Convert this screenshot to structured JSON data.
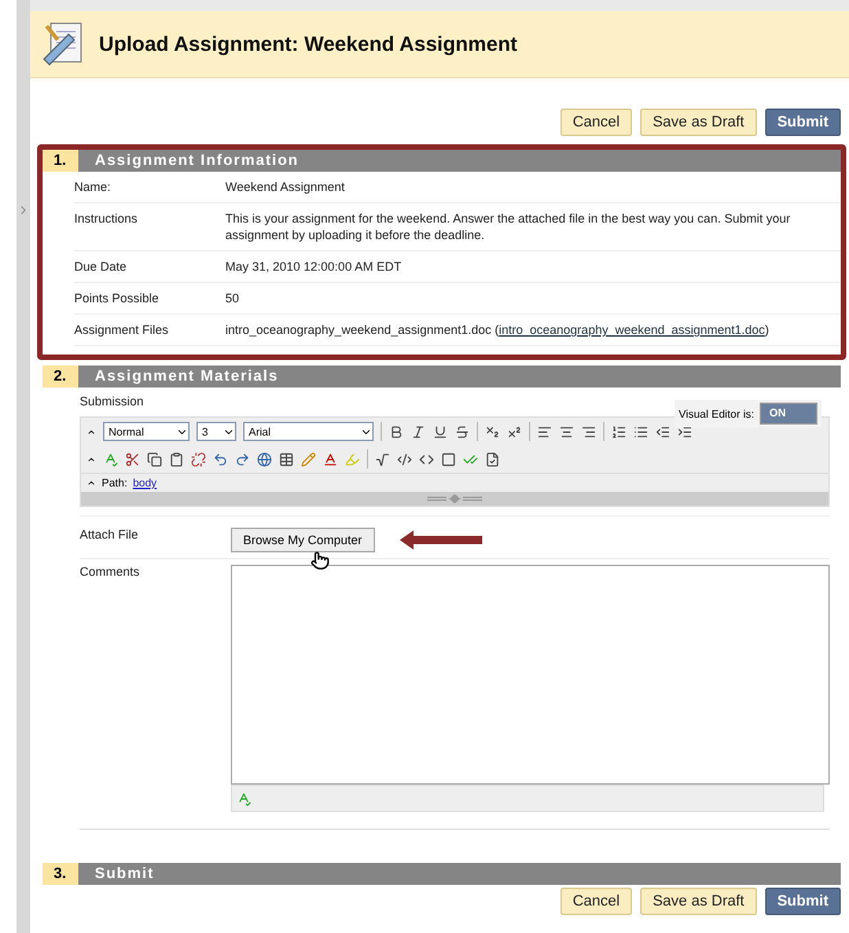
{
  "page_title": "Upload Assignment: Weekend Assignment",
  "top_buttons": [
    {
      "label": "Cancel",
      "kind": "plain"
    },
    {
      "label": "Save as Draft",
      "kind": "plain"
    },
    {
      "label": "Submit",
      "kind": "primary"
    }
  ],
  "info_section": {
    "number": "1.",
    "title": "Assignment Information",
    "highlighted": true,
    "fields": [
      {
        "label": "Name:",
        "value": "Weekend Assignment"
      },
      {
        "label": "Instructions",
        "value": "This is your assignment for the weekend. Answer the attached file in the best way you can. Submit your assignment by uploading it before the deadline."
      },
      {
        "label": "Due Date",
        "value": "May 31, 2010 12:00:00 AM EDT"
      },
      {
        "label": "Points Possible",
        "value": "50"
      },
      {
        "label": "Assignment Files",
        "value": "intro_oceanography_weekend_assignment1.doc (",
        "link": "intro_oceanography_weekend_assignment1.doc",
        "after": ")"
      }
    ]
  },
  "materials_section": {
    "number": "2.",
    "title": "Assignment Materials",
    "submission_label": "Submission",
    "visual_editor": {
      "label": "Visual Editor is:",
      "on": true,
      "state_text": "ON"
    },
    "toolbar": {
      "style": "Normal",
      "size": "3",
      "font": "Arial"
    },
    "path": {
      "label": "Path:",
      "link": "body"
    },
    "attach": {
      "label": "Attach File",
      "button": "Browse My Computer"
    },
    "comments": {
      "label": "Comments"
    }
  },
  "submit_section": {
    "number": "3.",
    "title": "Submit",
    "buttons": [
      {
        "label": "Cancel",
        "kind": "plain"
      },
      {
        "label": "Save as Draft",
        "kind": "plain"
      },
      {
        "label": "Submit",
        "kind": "primary"
      }
    ]
  }
}
